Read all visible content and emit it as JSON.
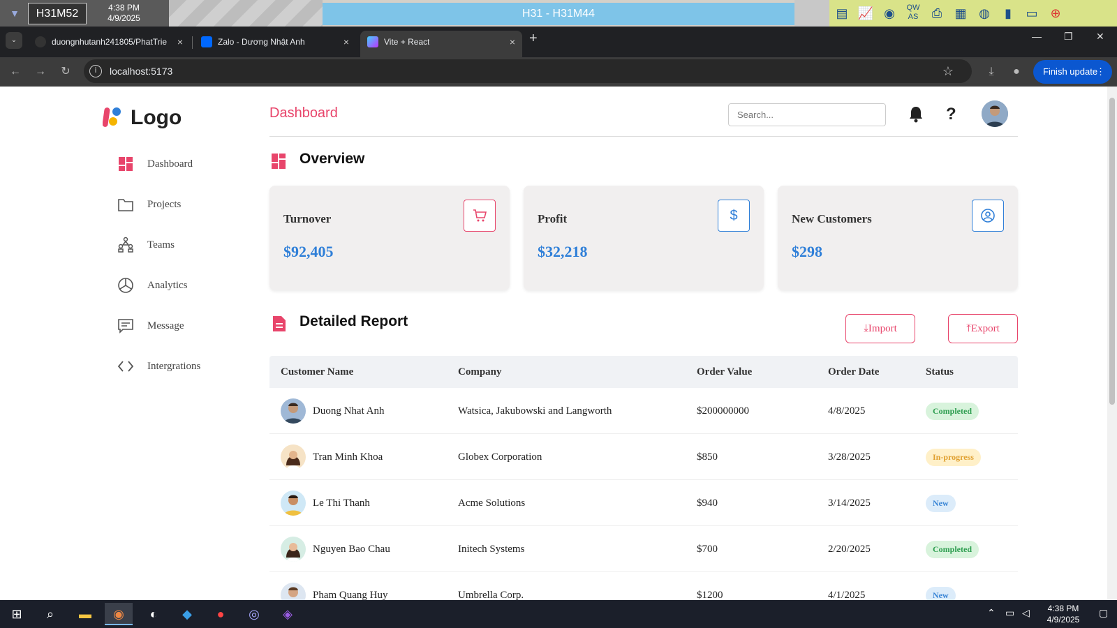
{
  "remote_desktop": {
    "host": "H31M52",
    "time": "4:38 PM",
    "date": "4/9/2025",
    "title": "H31 - H31M44"
  },
  "browser": {
    "tabs": [
      {
        "label": "duongnhutanh241805/PhatTrie",
        "close": "×"
      },
      {
        "label": "Zalo - Dương Nhật Anh",
        "close": "×"
      },
      {
        "label": "Vite + React",
        "close": "×"
      }
    ],
    "new_tab": "+",
    "url": "localhost:5173",
    "finish_update": "Finish update"
  },
  "sidebar": {
    "logo": "Logo",
    "items": [
      {
        "label": "Dashboard",
        "icon": "grid-icon"
      },
      {
        "label": "Projects",
        "icon": "folder-icon"
      },
      {
        "label": "Teams",
        "icon": "people-icon"
      },
      {
        "label": "Analytics",
        "icon": "pie-chart-icon"
      },
      {
        "label": "Message",
        "icon": "chat-icon"
      },
      {
        "label": "Intergrations",
        "icon": "code-icon"
      }
    ]
  },
  "header": {
    "title": "Dashboard",
    "search_placeholder": "Search...",
    "help": "?"
  },
  "overview": {
    "title": "Overview",
    "cards": [
      {
        "label": "Turnover",
        "value": "$92,405",
        "icon": "cart-icon",
        "color": "#e8456b"
      },
      {
        "label": "Profit",
        "value": "$32,218",
        "icon": "dollar-icon",
        "color": "#2f7fd8"
      },
      {
        "label": "New Customers",
        "value": "$298",
        "icon": "user-circle-icon",
        "color": "#2f7fd8"
      }
    ]
  },
  "report": {
    "title": "Detailed Report",
    "import_label": "Import",
    "export_label": "Export",
    "columns": [
      "Customer Name",
      "Company",
      "Order Value",
      "Order Date",
      "Status"
    ],
    "rows": [
      {
        "name": "Duong Nhat Anh",
        "company": "Watsica, Jakubowski and Langworth",
        "value": "$200000000",
        "date": "4/8/2025",
        "status": "Completed"
      },
      {
        "name": "Tran Minh Khoa",
        "company": "Globex Corporation",
        "value": "$850",
        "date": "3/28/2025",
        "status": "In-progress"
      },
      {
        "name": "Le Thi Thanh",
        "company": "Acme Solutions",
        "value": "$940",
        "date": "3/14/2025",
        "status": "New"
      },
      {
        "name": "Nguyen Bao Chau",
        "company": "Initech Systems",
        "value": "$700",
        "date": "2/20/2025",
        "status": "Completed"
      },
      {
        "name": "Pham Quang Huy",
        "company": "Umbrella Corp.",
        "value": "$1200",
        "date": "4/1/2025",
        "status": "New"
      }
    ]
  },
  "taskbar": {
    "time": "4:38 PM",
    "date": "4/9/2025"
  },
  "colors": {
    "accent": "#e8456b",
    "blue": "#2f7fd8",
    "completed_bg": "#d8f3dc",
    "completed_fg": "#2e9e50",
    "progress_bg": "#fff0c8",
    "progress_fg": "#e0a030",
    "new_bg": "#dcecfa",
    "new_fg": "#3a86d6"
  }
}
